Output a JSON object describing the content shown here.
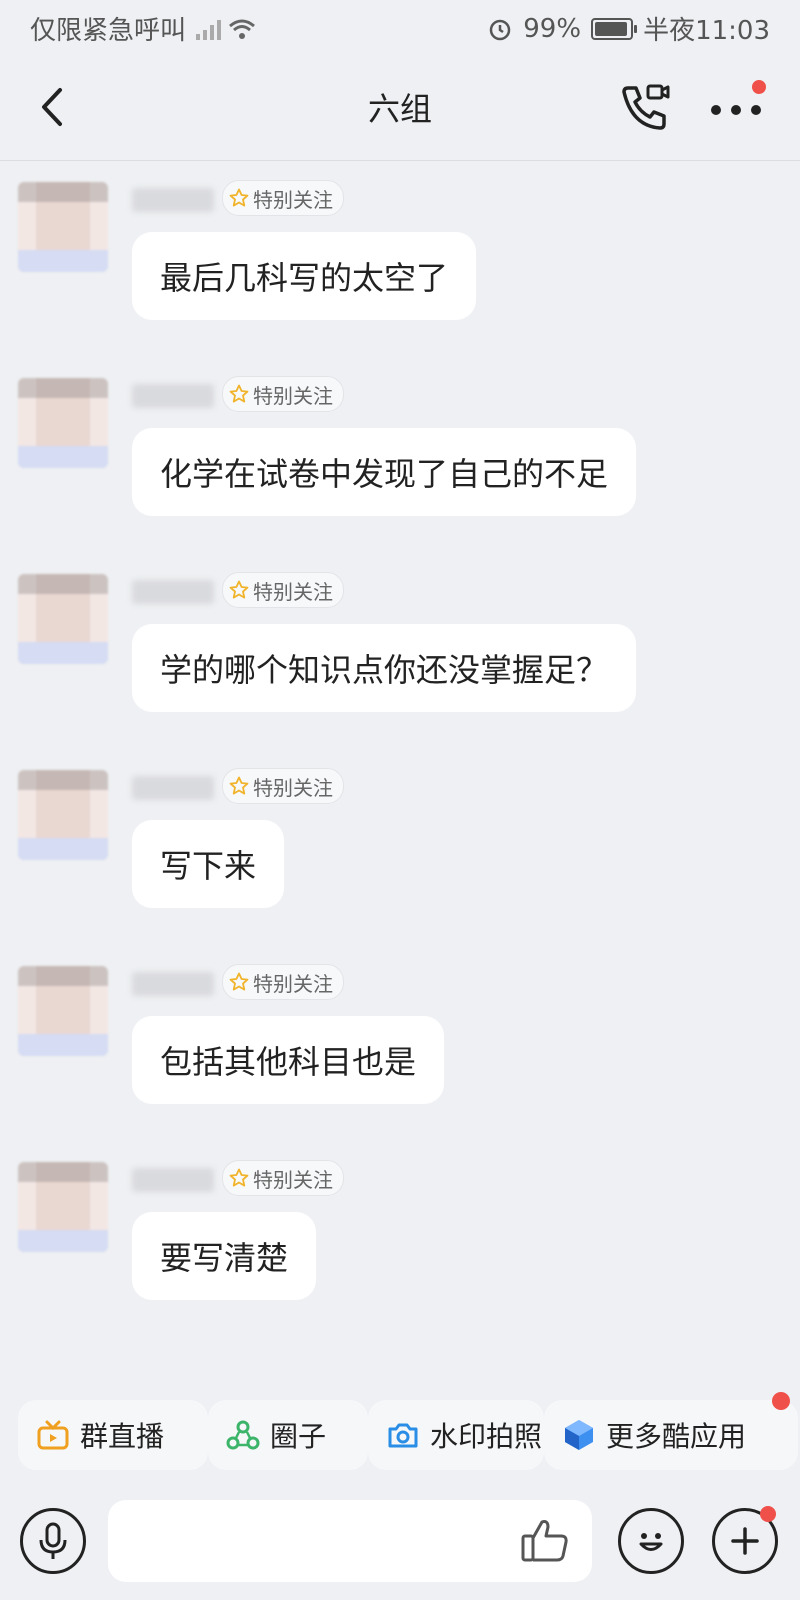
{
  "status_bar": {
    "carrier": "仅限紧急呼叫",
    "battery": "99%",
    "time": "半夜11:03"
  },
  "header": {
    "title": "六组",
    "back_icon": "chevron-left-icon",
    "call_icon": "phone-video-icon",
    "more_icon": "more-dots-icon"
  },
  "messages": [
    {
      "tag": "特别关注",
      "text": "最后几科写的太空了"
    },
    {
      "tag": "特别关注",
      "text": "化学在试卷中发现了自己的不足"
    },
    {
      "tag": "特别关注",
      "text": "学的哪个知识点你还没掌握足？"
    },
    {
      "tag": "特别关注",
      "text": "写下来"
    },
    {
      "tag": "特别关注",
      "text": "包括其他科目也是"
    },
    {
      "tag": "特别关注",
      "text": "要写清楚"
    }
  ],
  "quick_apps": [
    {
      "label": "群直播",
      "icon": "tv-icon"
    },
    {
      "label": "圈子",
      "icon": "circle-group-icon"
    },
    {
      "label": "水印拍照",
      "icon": "camera-icon"
    },
    {
      "label": "更多酷应用",
      "icon": "cube-app-icon"
    }
  ],
  "input": {
    "placeholder": "",
    "voice_icon": "microphone-icon",
    "like_icon": "thumbs-up-icon",
    "emoji_icon": "emoji-icon",
    "plus_icon": "plus-icon"
  },
  "colors": {
    "background": "#eef0f3",
    "bubble": "#ffffff",
    "badge_red": "#f0504a",
    "star": "#f0b32a"
  }
}
